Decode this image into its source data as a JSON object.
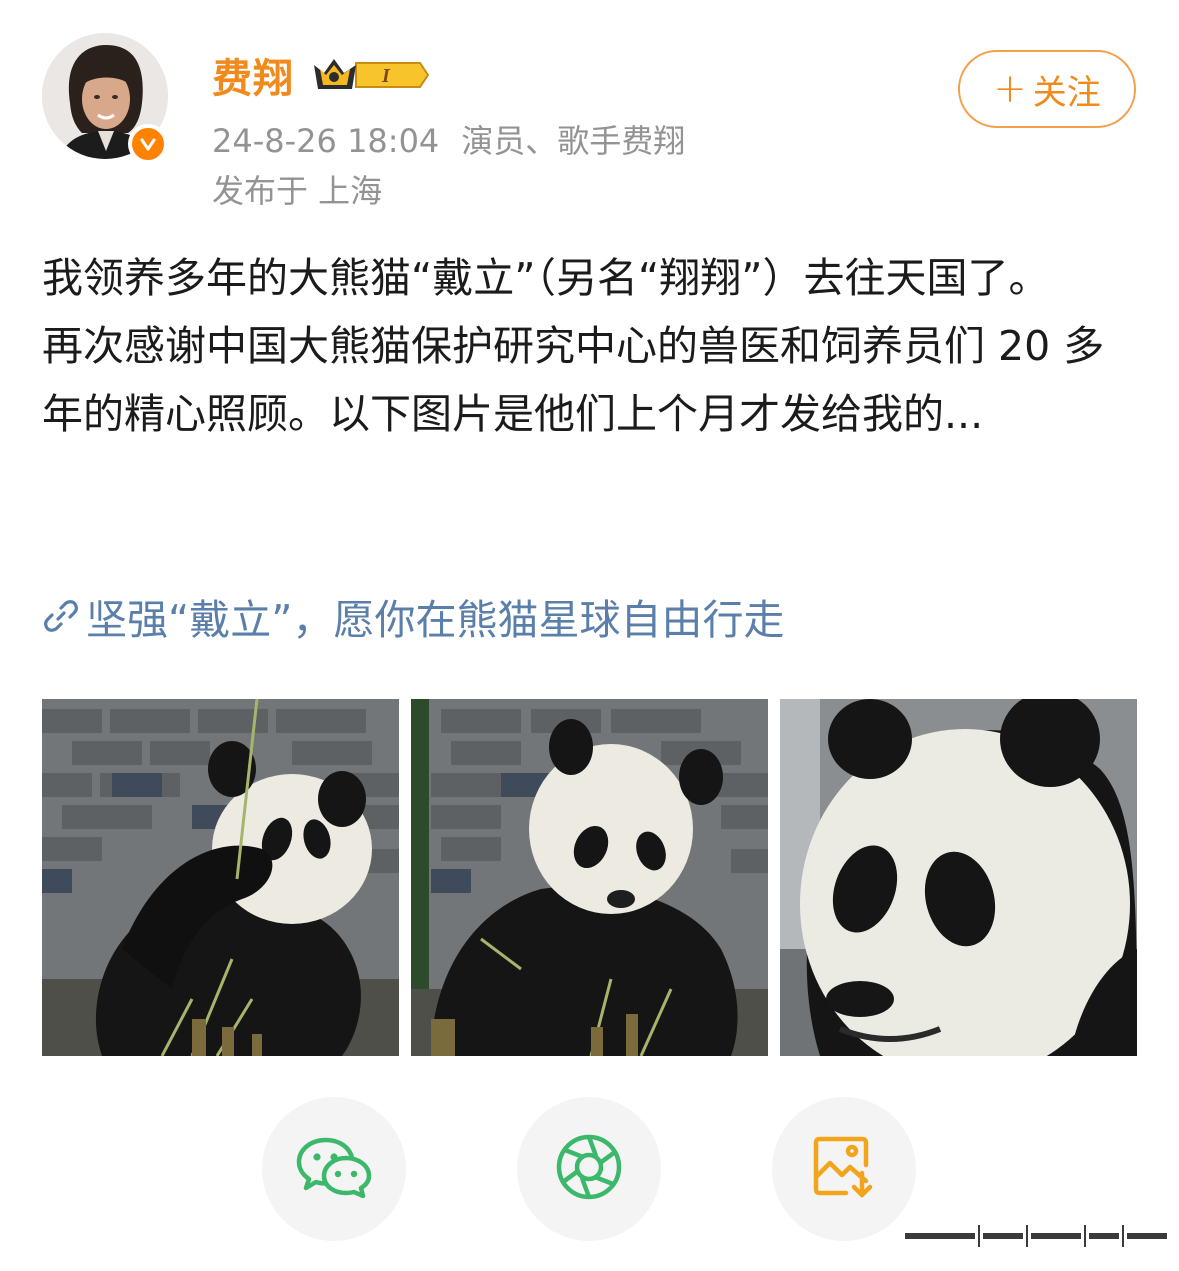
{
  "post": {
    "author": {
      "name": "费翔",
      "verified": true,
      "vip_level": "I"
    },
    "timestamp": "24-8-26 18:04",
    "author_desc": "演员、歌手费翔",
    "location": "发布于 上海",
    "follow_label": "关注",
    "follow_plus": "+",
    "body": [
      "我领养多年的大熊猫“戴立”（另名“翔翔”）去往天国了。",
      "再次感谢中国大熊猫保护研究中心的兽医和饲养员们 20 多年的精心照顾。以下图片是他们上个月才发给我的..."
    ],
    "link_text": "坚强“戴立”，愿你在熊猫星球自由行走",
    "photos": [
      {
        "subject": "panda eating bamboo"
      },
      {
        "subject": "panda sitting"
      },
      {
        "subject": "panda face close-up"
      }
    ]
  },
  "share": {
    "buttons": [
      {
        "icon": "wechat-icon",
        "color": "#3bb86a"
      },
      {
        "icon": "moments-icon",
        "color": "#3bb86a"
      },
      {
        "icon": "save-image-icon",
        "color": "#f2a51a"
      }
    ]
  },
  "colors": {
    "name": "#f08a1c",
    "meta": "#939393",
    "link": "#5a7fab",
    "follow_border": "#f2a04c",
    "verified_badge": "#ff8200"
  }
}
